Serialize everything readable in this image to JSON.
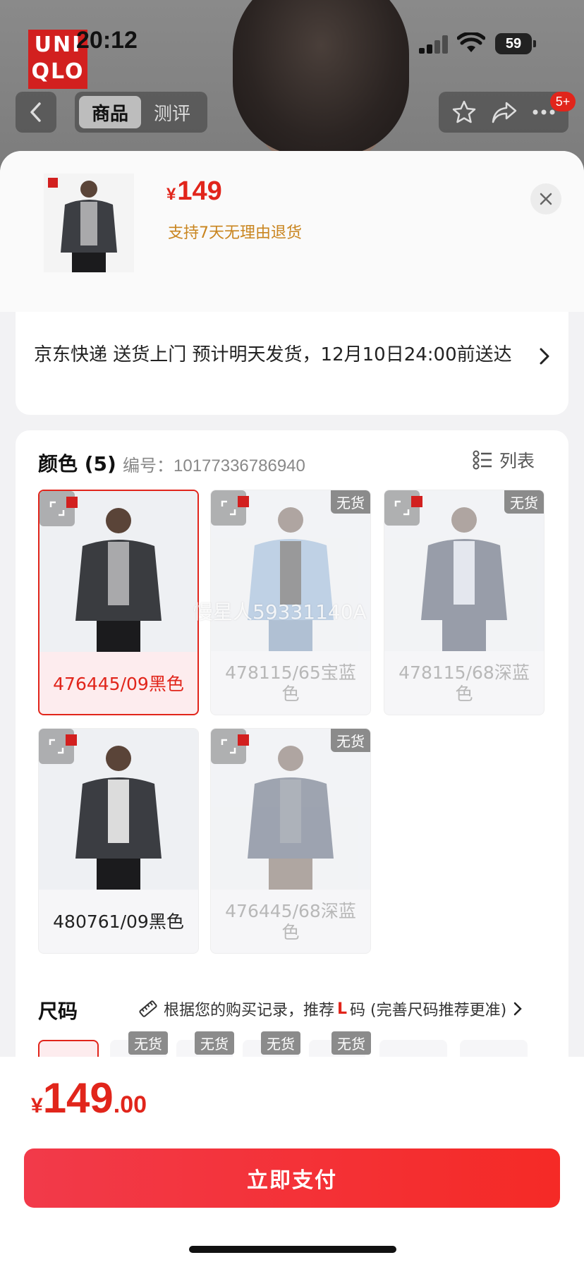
{
  "status_bar": {
    "time": "20:12",
    "battery": "59"
  },
  "brand_logo": [
    "UNI",
    "QLO"
  ],
  "nav": {
    "tabs": [
      {
        "label": "商品",
        "active": true
      },
      {
        "label": "测评",
        "active": false
      }
    ],
    "badge": "5+"
  },
  "sheet": {
    "price": {
      "symbol": "¥",
      "value": "149"
    },
    "return_note": "支持7天无理由退货",
    "delivery": "京东快递 送货上门 预计明天发货，12月10日24:00前送达"
  },
  "color_section": {
    "title": "颜色 (5)",
    "sku": "编号：10177336786940",
    "view_toggle": "列表",
    "oos_label": "无货",
    "watermark": "慢星人59331140A",
    "items": [
      {
        "label": "476445/09黑色",
        "selected": true,
        "out_of_stock": false,
        "shirt": "#3a3c40",
        "inner": "#a9a9ab",
        "pants": "#1b1b1d"
      },
      {
        "label": "478115/65宝蓝色",
        "selected": false,
        "out_of_stock": true,
        "shirt": "#7ea6cf",
        "inner": "#2a2a2a",
        "pants": "#5d7fa8"
      },
      {
        "label": "478115/68深蓝色",
        "selected": false,
        "out_of_stock": true,
        "shirt": "#27334a",
        "inner": "#cfd6e3",
        "pants": "#27334a"
      },
      {
        "label": "480761/09黑色",
        "selected": false,
        "out_of_stock": false,
        "shirt": "#3b3d42",
        "inner": "#dcdcdc",
        "pants": "#1b1b1d"
      },
      {
        "label": "476445/68深蓝色",
        "selected": false,
        "out_of_stock": true,
        "shirt": "#33405a",
        "inner": "#556070",
        "pants": "#5b4638"
      }
    ]
  },
  "size_section": {
    "title": "尺码",
    "rec_prefix": "根据您的购买记录，推荐",
    "rec_size": "L",
    "rec_suffix": "码 (完善尺码推荐更准)",
    "oos_label": "无货"
  },
  "bottom": {
    "total": {
      "symbol": "¥",
      "integer": "149",
      "decimal": ".00"
    },
    "pay_label": "立即支付"
  },
  "colors": {
    "accent": "#e1251b",
    "gold_note": "#c9851f"
  }
}
